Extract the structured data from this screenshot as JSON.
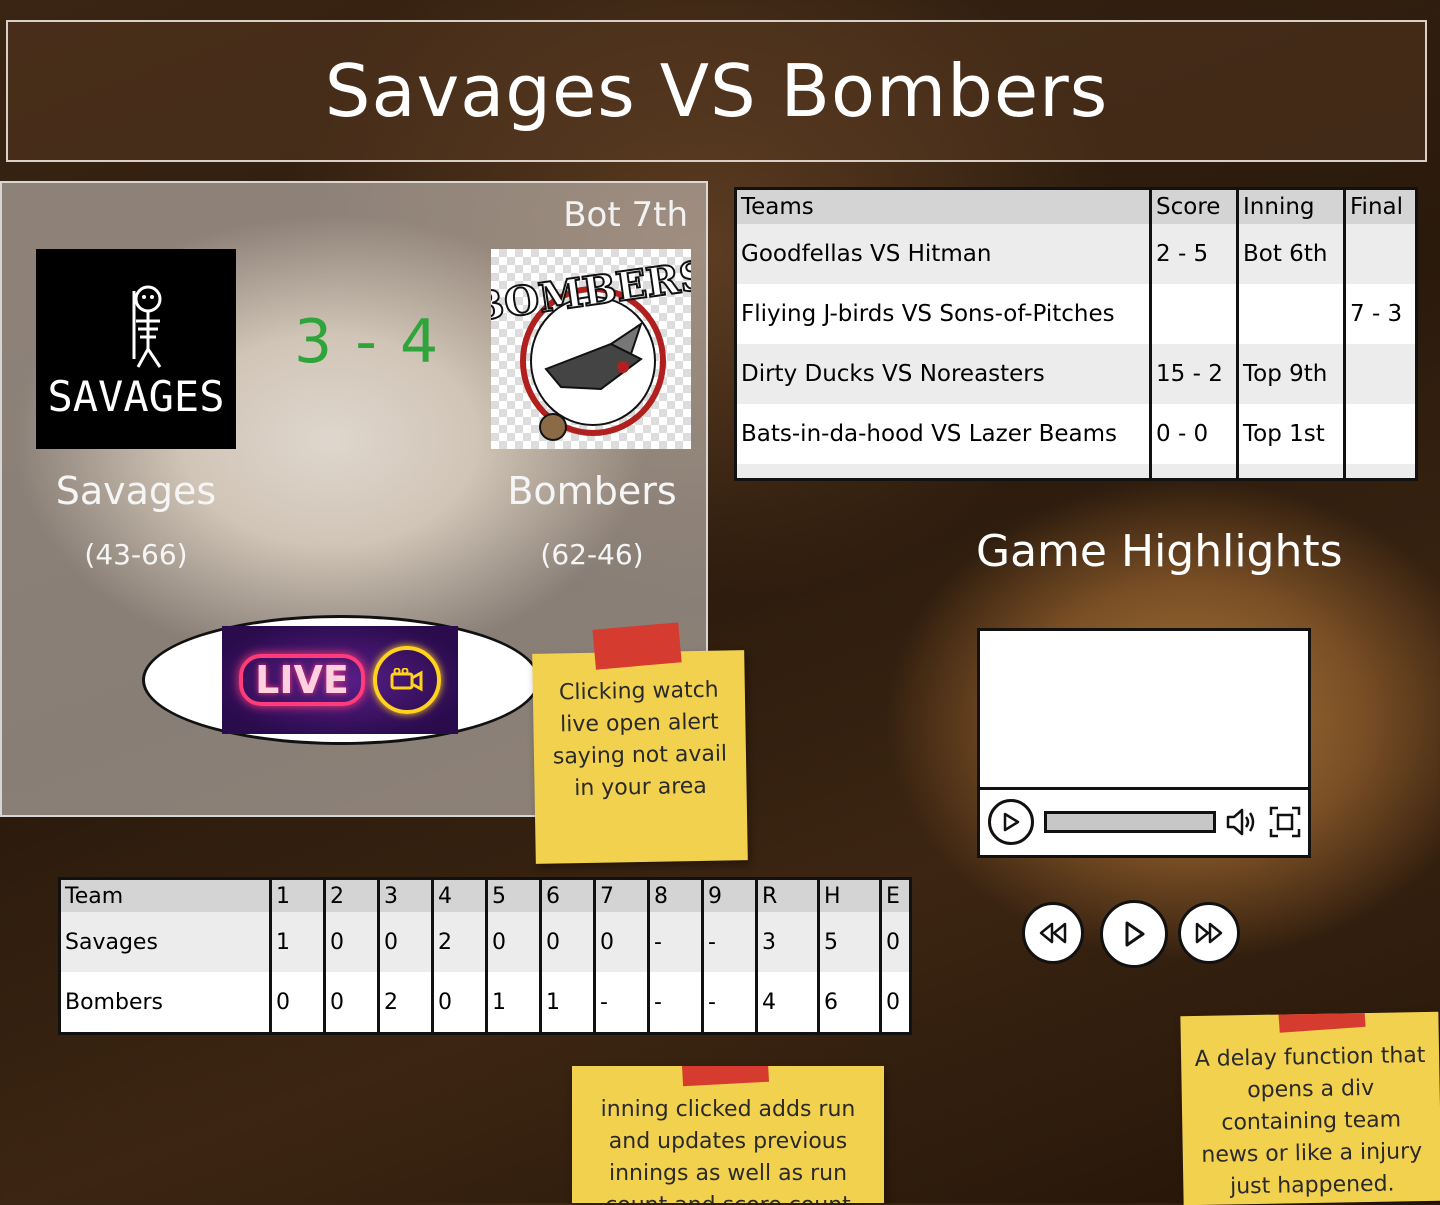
{
  "header": {
    "title": "Savages VS Bombers"
  },
  "game": {
    "inning": "Bot 7th",
    "score": "3 - 4",
    "home": {
      "name": "Savages",
      "record": "(43-66)",
      "logo_text": "SAVAGES"
    },
    "away": {
      "name": "Bombers",
      "record": "(62-46)",
      "logo_text": "BOMBERS"
    },
    "live_label": "LIVE"
  },
  "other_games": {
    "headers": [
      "Teams",
      "Score",
      "Inning",
      "Final"
    ],
    "rows": [
      [
        "Goodfellas VS Hitman",
        "2 - 5",
        "Bot 6th",
        ""
      ],
      [
        "Fliying J-birds VS Sons-of-Pitches",
        "",
        "",
        "7 - 3"
      ],
      [
        "Dirty Ducks VS Noreasters",
        "15 - 2",
        "Top 9th",
        ""
      ],
      [
        "Bats-in-da-hood VS Lazer Beams",
        "0 - 0",
        "Top 1st",
        ""
      ]
    ]
  },
  "highlights": {
    "title": "Game Highlights"
  },
  "boxscore": {
    "headers": [
      "Team",
      "1",
      "2",
      "3",
      "4",
      "5",
      "6",
      "7",
      "8",
      "9",
      "R",
      "H",
      "E"
    ],
    "rows": [
      [
        "Savages",
        "1",
        "0",
        "0",
        "2",
        "0",
        "0",
        "0",
        "-",
        "-",
        "3",
        "5",
        "0"
      ],
      [
        "Bombers",
        "0",
        "0",
        "2",
        "0",
        "1",
        "1",
        "-",
        "-",
        "-",
        "4",
        "6",
        "0"
      ]
    ]
  },
  "notes": {
    "live_note": "Clicking watch live open alert saying not avail in your area",
    "inning_note": "inning clicked adds run and updates previous innings as well as run count and score count",
    "delay_note": "A delay function that opens a div containing team news or like a injury just happened."
  },
  "colors": {
    "score": "#2ea43a",
    "sticky": "#f2d14e",
    "tape": "#d63b2f",
    "live_neon": "#ff3b7a"
  }
}
